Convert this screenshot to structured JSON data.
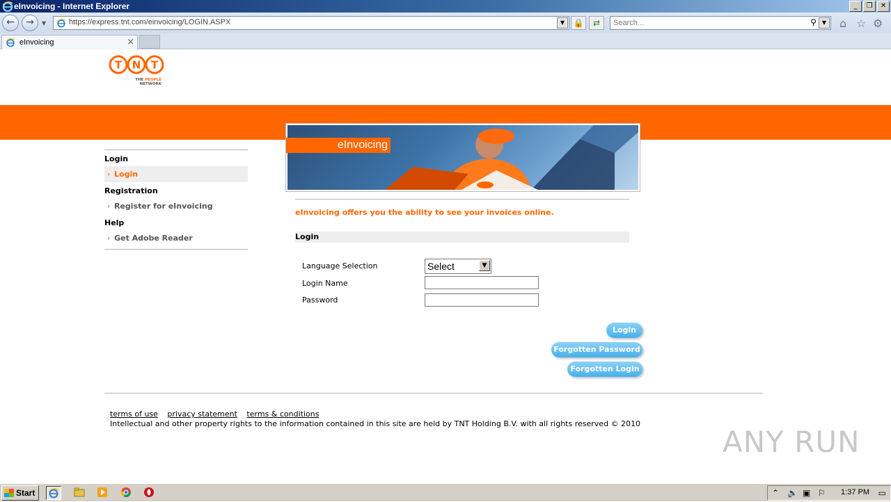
{
  "window": {
    "title": "eInvoicing - Internet Explorer"
  },
  "browser": {
    "url": "https://express.tnt.com/einvoicing/LOGIN.ASPX",
    "search_placeholder": "Search...",
    "tab_label": "eInvoicing"
  },
  "banner": {
    "label": "eInvoicing"
  },
  "sidebar": {
    "sections": [
      {
        "heading": "Login",
        "items": [
          {
            "label": "Login",
            "active": true
          }
        ]
      },
      {
        "heading": "Registration",
        "items": [
          {
            "label": "Register for eInvoicing",
            "active": false
          }
        ]
      },
      {
        "heading": "Help",
        "items": [
          {
            "label": "Get Adobe Reader",
            "active": false
          }
        ]
      }
    ]
  },
  "main": {
    "intro": "eInvoicing offers you the ability to see your invoices online.",
    "section_title": "Login",
    "fields": {
      "language_label": "Language Selection",
      "language_value": "Select",
      "login_name_label": "Login Name",
      "login_name_value": "",
      "password_label": "Password",
      "password_value": ""
    },
    "buttons": {
      "login": "Login",
      "forgotten_password": "Forgotten Password",
      "forgotten_login": "Forgotten Login"
    }
  },
  "footer": {
    "links": [
      "terms of use",
      "privacy statement",
      "terms & conditions"
    ],
    "copyright": "Intellectual and other property rights to the information contained in this site are held by TNT Holding B.V. with all rights reserved © 2010"
  },
  "watermark": "ANY RUN",
  "taskbar": {
    "start_label": "Start",
    "clock": "1:37 PM"
  },
  "colors": {
    "brand_orange": "#ff6600",
    "button_blue": "#44b0ea"
  }
}
